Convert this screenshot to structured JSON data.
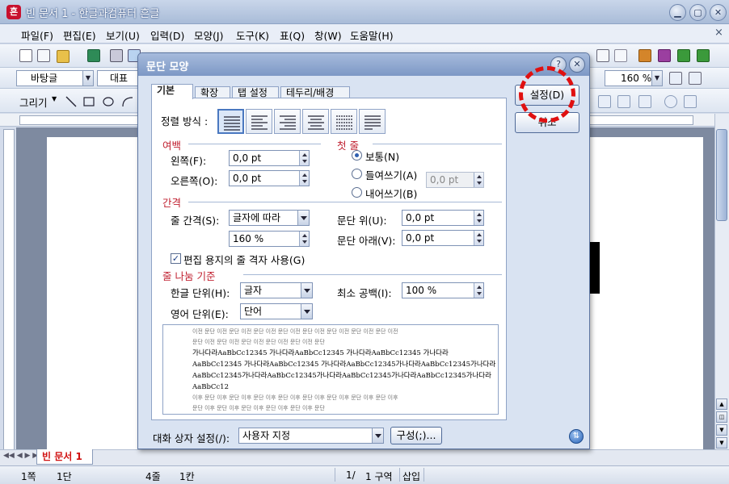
{
  "app": {
    "icon_char": "흔",
    "title": "빈 문서 1 - 한글과컴퓨터 흔글"
  },
  "window_buttons": {
    "minimize": "▁",
    "maximize": "▢",
    "close": "✕"
  },
  "menu": [
    "파일(F)",
    "편집(E)",
    "보기(U)",
    "입력(D)",
    "모양(J)",
    "도구(K)",
    "표(Q)",
    "창(W)",
    "도움말(H)"
  ],
  "menu_close": "×",
  "format_bar": {
    "style_value": "바탕글",
    "font_value": "대표",
    "zoom_value": "160 %"
  },
  "draw_bar": {
    "label": "그리기"
  },
  "doc_tab": {
    "label": "빈 문서 1"
  },
  "status": {
    "page": "1쪽",
    "section": "1단",
    "line": "4줄",
    "column": "1칸",
    "position": "1/",
    "block": "1 구역",
    "mode": "삽입"
  },
  "dialog": {
    "title": "문단 모양",
    "tabs": [
      "기본",
      "확장",
      "탭 설정",
      "테두리/배경"
    ],
    "align_label": "정렬 방식 :",
    "margin": {
      "section": "여백",
      "left_label": "왼쪽(F):",
      "left_value": "0,0 pt",
      "right_label": "오른쪽(O):",
      "right_value": "0,0 pt"
    },
    "first_line": {
      "section": "첫 줄",
      "normal": "보통(N)",
      "indent": "들여쓰기(A)",
      "outdent": "내어쓰기(B)",
      "value": "0,0 pt"
    },
    "spacing": {
      "section": "간격",
      "line_label": "줄 간격(S):",
      "line_type": "글자에 따라",
      "line_value": "160 %",
      "above_label": "문단 위(U):",
      "above_value": "0,0 pt",
      "below_label": "문단 아래(V):",
      "below_value": "0,0 pt",
      "grid_check": "편집 용지의 줄 격자 사용(G)"
    },
    "line_break": {
      "section": "줄 나눔 기준",
      "korean_label": "한글 단위(H):",
      "korean_value": "글자",
      "english_label": "영어 단위(E):",
      "english_value": "단어",
      "min_space_label": "최소 공백(I):",
      "min_space_value": "100 %"
    },
    "preview": {
      "prev_lines": [
        "이전 문단 이전 문단 이전 문단 이전 문단 이전 문단 이전 문단 이전 문단 이전 문단 이전",
        "문단 이전 문단 이전 문단 이전 문단 이전 문단 이전 문단"
      ],
      "sample_lines": [
        "가나다라AaBbCc12345      가나다라AaBbCc12345      가나다라AaBbCc12345      가나다라",
        "AaBbCc12345 가나다라AaBbCc12345 가나다라AaBbCc12345가나다라AaBbCc12345가나다라",
        "AaBbCc12345가나다라AaBbCc12345가나다라AaBbCc12345가나다라AaBbCc12345가나다라",
        "AaBbCc12"
      ],
      "next_lines": [
        "이후 문단 이후 문단 이후 문단 이후 문단 이후 문단 이후 문단 이후 문단 이후 문단 이후",
        "문단 이후 문단 이후 문단 이후 문단 이후 문단 이후 문단"
      ]
    },
    "buttons": {
      "ok": "설정(D)",
      "cancel": "취소",
      "configure": "구성(;)..."
    },
    "dialog_setting_label": "대화 상자 설정(/):",
    "dialog_setting_value": "사용자 지정"
  },
  "colors": {
    "highlight_circle": "#e01010"
  }
}
